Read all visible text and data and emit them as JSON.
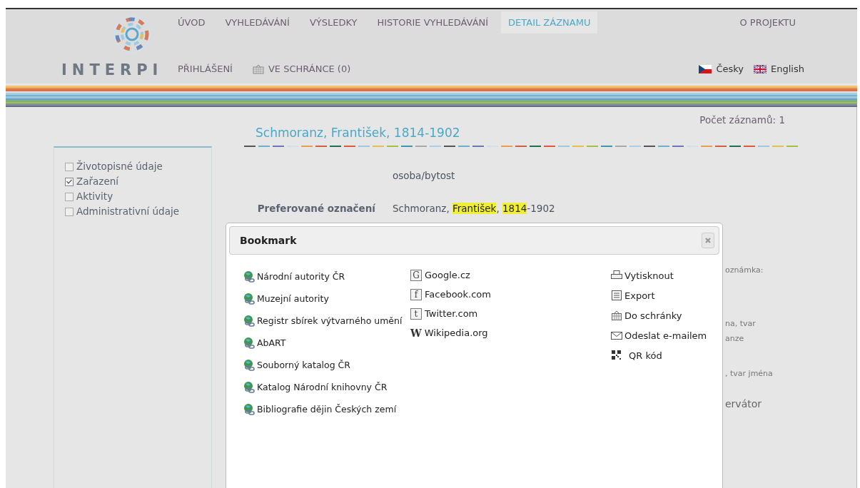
{
  "header": {
    "logo_text": "INTERPI",
    "nav": [
      {
        "label": "ÚVOD",
        "selected": false
      },
      {
        "label": "VYHLEDÁVÁNÍ",
        "selected": false
      },
      {
        "label": "VÝSLEDKY",
        "selected": false
      },
      {
        "label": "HISTORIE VYHLEDÁVÁNÍ",
        "selected": false
      },
      {
        "label": "DETAIL ZÁZNAMU",
        "selected": true
      },
      {
        "label": "O PROJEKTU",
        "selected": false
      }
    ],
    "login": "PŘIHLÁŠENÍ",
    "basket": "VE SCHRÁNCE (0)",
    "languages": [
      {
        "label": "Česky",
        "kind": "cz"
      },
      {
        "label": "English",
        "kind": "gb"
      }
    ]
  },
  "record_count": "Počet záznamů: 1",
  "title": "Schmoranz, František, 1814-1902",
  "sections": [
    {
      "label": "Životopisné údaje",
      "checked": false
    },
    {
      "label": "Zařazení",
      "checked": true
    },
    {
      "label": "Aktivity",
      "checked": false
    },
    {
      "label": "Administrativní údaje",
      "checked": false
    }
  ],
  "fields": [
    {
      "value_parts": [
        {
          "text": "osoba/bytost",
          "highlighted": false
        }
      ]
    },
    {
      "label": "Preferované označení",
      "value_parts": [
        {
          "text": "Schmoranz, ",
          "highlighted": false
        },
        {
          "text": "František",
          "highlighted": true
        },
        {
          "text": ", ",
          "highlighted": false
        },
        {
          "text": "1814",
          "highlighted": true
        },
        {
          "text": "-1902",
          "highlighted": false
        }
      ]
    }
  ],
  "fragments": [
    {
      "text": "oznámka:",
      "kind": "note"
    },
    {
      "text": "na, tvar",
      "kind": "note"
    },
    {
      "text": "anze",
      "kind": "note"
    },
    {
      "text": ", tvar jména",
      "kind": "note"
    },
    {
      "text": "ervátor",
      "kind": "heading"
    }
  ],
  "dialog": {
    "title": "Bookmark",
    "authorities": [
      "Národní autority ČR",
      "Muzejní autority",
      "Registr sbírek výtvarného umění",
      "AbART",
      "Souborný katalog ČR",
      "Katalog Národní knihovny ČR",
      "Bibliografie dějin Českých zemí"
    ],
    "web": [
      {
        "label": "Google.cz",
        "glyph": "G",
        "kind": "boxed"
      },
      {
        "label": "Facebook.com",
        "glyph": "f",
        "kind": "boxed"
      },
      {
        "label": "Twitter.com",
        "glyph": "t",
        "kind": "boxed"
      },
      {
        "label": "Wikipedia.org",
        "glyph": "W",
        "kind": "plain"
      }
    ],
    "actions": [
      {
        "label": "Vytisknout",
        "kind": "print"
      },
      {
        "label": "Export",
        "kind": "export"
      },
      {
        "label": "Do schránky",
        "kind": "basket"
      },
      {
        "label": "Odeslat e-mailem",
        "kind": "mail"
      },
      {
        "label": "QR kód",
        "kind": "qr"
      }
    ]
  }
}
